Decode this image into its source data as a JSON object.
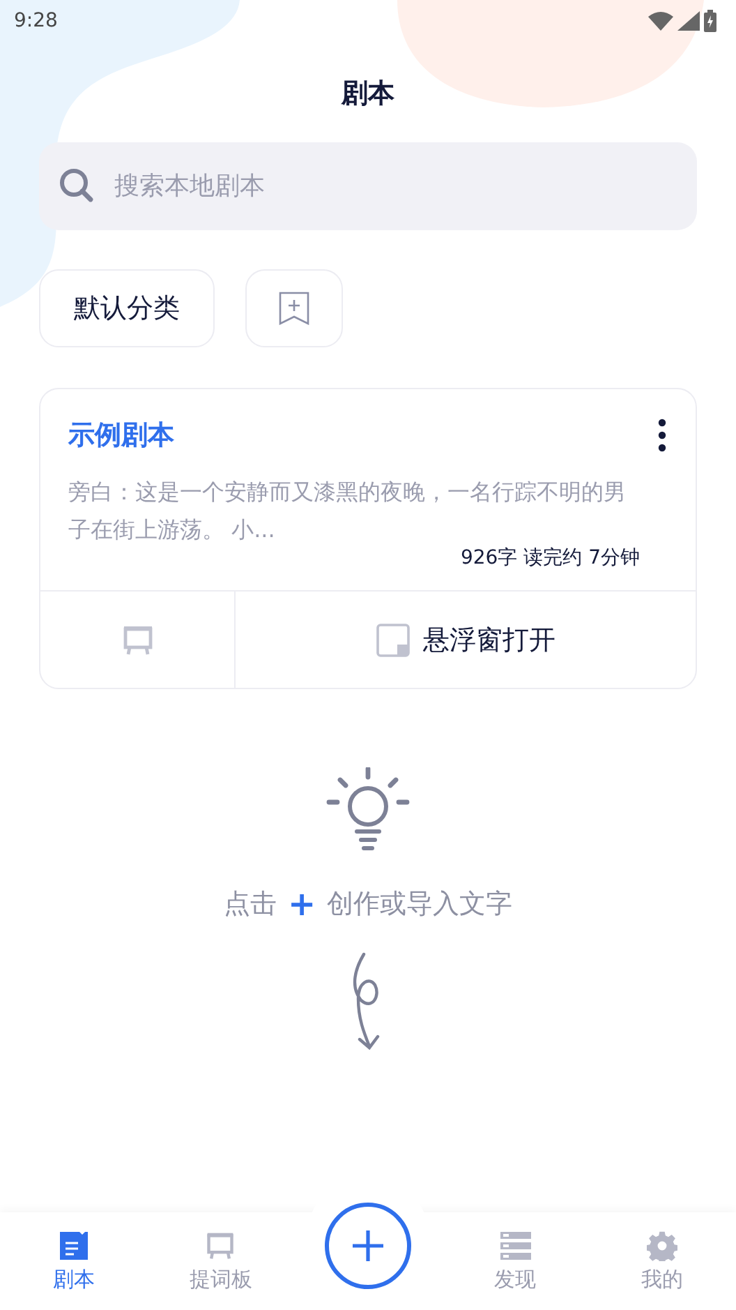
{
  "status_bar": {
    "time": "9:28"
  },
  "title": "剧本",
  "search": {
    "placeholder": "搜索本地剧本"
  },
  "categories": [
    {
      "kind": "label",
      "label": "默认分类"
    },
    {
      "kind": "add"
    }
  ],
  "scripts": [
    {
      "title": "示例剧本",
      "excerpt": "旁白：这是一个安静而又漆黑的夜晚，一名行踪不明的男子在街上游荡。 小...",
      "stats": "926字 读完约 7分钟",
      "open_label": "悬浮窗打开"
    }
  ],
  "hint": {
    "before": "点击",
    "plus": "+",
    "after": "创作或导入文字"
  },
  "nav": [
    {
      "kind": "tab",
      "label": "剧本",
      "selected": true
    },
    {
      "kind": "tab",
      "label": "提词板",
      "selected": false
    },
    {
      "kind": "add"
    },
    {
      "kind": "tab",
      "label": "发现",
      "selected": false
    },
    {
      "kind": "tab",
      "label": "我的",
      "selected": false
    }
  ]
}
